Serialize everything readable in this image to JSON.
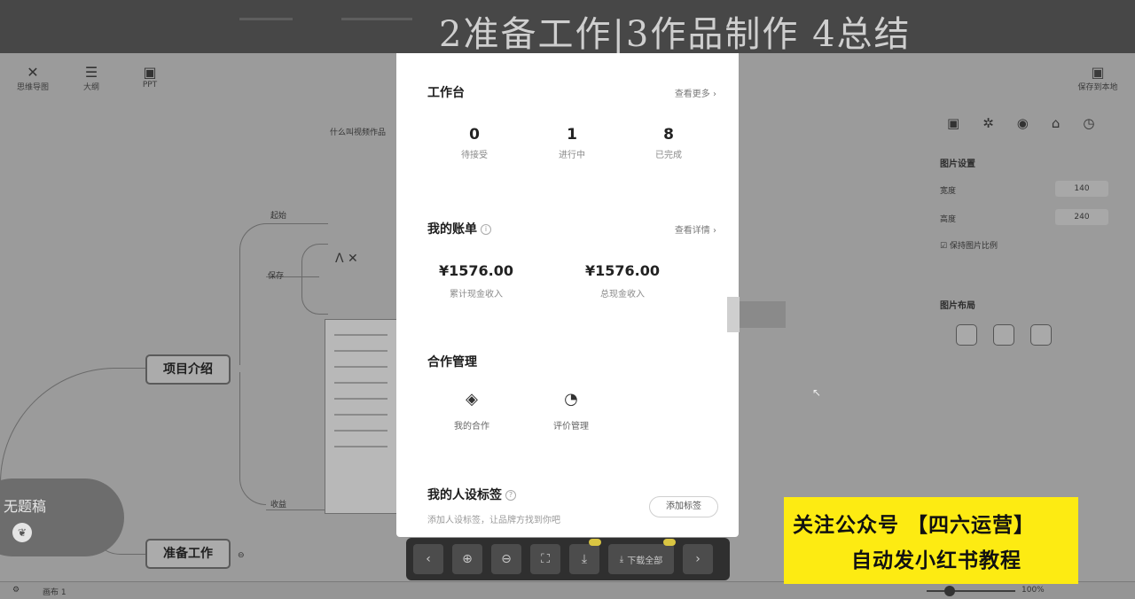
{
  "banner": {
    "title": "2准备工作|3作品制作  4总结"
  },
  "background_app": {
    "toolbar": [
      {
        "label": "思维导图",
        "icon": "mindmap-icon",
        "glyph": "✕"
      },
      {
        "label": "大纲",
        "icon": "outline-icon",
        "glyph": "☰"
      },
      {
        "label": "PPT",
        "icon": "ppt-icon",
        "glyph": "▣"
      }
    ],
    "topright_label": "保存到本地",
    "nodes": {
      "root": "无题稿",
      "project_intro": "项目介绍",
      "prep_work": "准备工作",
      "branch_a": "起始",
      "branch_b": "保存",
      "branch_c": "收益"
    },
    "side_text": "什么叫视频作品",
    "panel_title": "图片设置",
    "width_label": "宽度",
    "width_value": "140",
    "height_label": "高度",
    "height_value": "240",
    "lock_label": "保持图片比例",
    "layout_label": "图片布局",
    "status_left": "画布 1",
    "status_right": "100%"
  },
  "modal": {
    "workbench": {
      "title": "工作台",
      "link": "查看更多 ›",
      "stats": [
        {
          "value": "0",
          "label": "待接受"
        },
        {
          "value": "1",
          "label": "进行中"
        },
        {
          "value": "8",
          "label": "已完成"
        }
      ]
    },
    "bill": {
      "title": "我的账单",
      "link": "查看详情 ›",
      "items": [
        {
          "value": "¥1576.00",
          "label": "累计现金收入"
        },
        {
          "value": "¥1576.00",
          "label": "总现金收入"
        }
      ]
    },
    "coop": {
      "title": "合作管理",
      "items": [
        {
          "label": "我的合作",
          "icon": "cooperation-icon",
          "glyph": "◈"
        },
        {
          "label": "评价管理",
          "icon": "review-icon",
          "glyph": "◔"
        }
      ]
    },
    "tags": {
      "title": "我的人设标签",
      "desc": "添加人设标签，让品牌方找到你吧",
      "button": "添加标签"
    }
  },
  "toolbar": {
    "buttons": [
      {
        "icon": "chevron-left-icon",
        "glyph": "‹"
      },
      {
        "icon": "zoom-in-icon",
        "glyph": "⊕"
      },
      {
        "icon": "zoom-out-icon",
        "glyph": "⊖"
      },
      {
        "icon": "fullscreen-icon",
        "glyph": "⛶"
      },
      {
        "icon": "download-icon",
        "glyph": "⤓"
      }
    ],
    "download_all_label": "下载全部",
    "next_glyph": "›"
  },
  "promo": {
    "line1": "关注公众号 【四六运营】",
    "line2": "自动发小红书教程"
  },
  "colors": {
    "promo": "#fdeb12",
    "modal_bg": "#ffffff",
    "toolbar_bg": "#2f2f2f"
  }
}
